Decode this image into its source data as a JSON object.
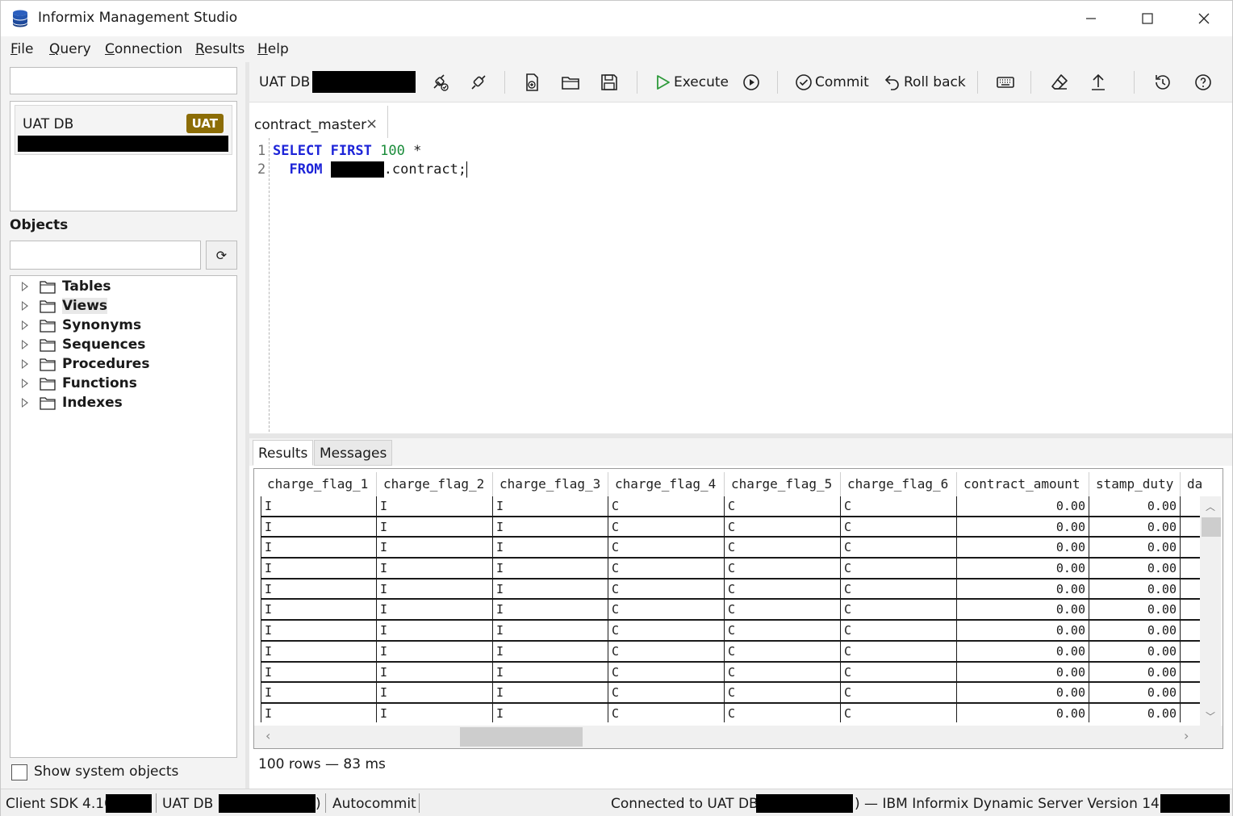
{
  "window": {
    "title": "Informix Management Studio"
  },
  "menu": [
    "File",
    "Query",
    "Connection",
    "Results",
    "Help"
  ],
  "connections": {
    "search_value": "",
    "items": [
      {
        "name": "UAT DB",
        "badge": "UAT"
      }
    ]
  },
  "objects": {
    "label": "Objects",
    "search_value": "",
    "refresh_icon": "refresh-icon",
    "tree": [
      "Tables",
      "Views",
      "Synonyms",
      "Sequences",
      "Procedures",
      "Functions",
      "Indexes"
    ],
    "show_system_label": "Show system objects"
  },
  "toolbar": {
    "connection_label": "UAT DB",
    "execute_label": "Execute",
    "commit_label": "Commit",
    "rollback_label": "Roll back"
  },
  "editor_tab": {
    "label": "contract_master",
    "close": "×"
  },
  "editor": {
    "line_numbers": [
      "1",
      "2"
    ],
    "line1_kw1": "SELECT",
    "line1_kw2": "FIRST",
    "line1_num": "100",
    "line1_rest": " *",
    "line2_kw": "FROM",
    "line2_rest": ".contract;"
  },
  "result_tabs": [
    "Results",
    "Messages"
  ],
  "grid": {
    "columns": [
      "charge_flag_1",
      "charge_flag_2",
      "charge_flag_3",
      "charge_flag_4",
      "charge_flag_5",
      "charge_flag_6",
      "contract_amount",
      "stamp_duty",
      "da"
    ],
    "rows": [
      [
        "I",
        "I",
        "I",
        "C",
        "C",
        "C",
        "0.00",
        "0.00"
      ],
      [
        "I",
        "I",
        "I",
        "C",
        "C",
        "C",
        "0.00",
        "0.00"
      ],
      [
        "I",
        "I",
        "I",
        "C",
        "C",
        "C",
        "0.00",
        "0.00"
      ],
      [
        "I",
        "I",
        "I",
        "C",
        "C",
        "C",
        "0.00",
        "0.00"
      ],
      [
        "I",
        "I",
        "I",
        "C",
        "C",
        "C",
        "0.00",
        "0.00"
      ],
      [
        "I",
        "I",
        "I",
        "C",
        "C",
        "C",
        "0.00",
        "0.00"
      ],
      [
        "I",
        "I",
        "I",
        "C",
        "C",
        "C",
        "0.00",
        "0.00"
      ],
      [
        "I",
        "I",
        "I",
        "C",
        "C",
        "C",
        "0.00",
        "0.00"
      ],
      [
        "I",
        "I",
        "I",
        "C",
        "C",
        "C",
        "0.00",
        "0.00"
      ],
      [
        "I",
        "I",
        "I",
        "C",
        "C",
        "C",
        "0.00",
        "0.00"
      ],
      [
        "I",
        "I",
        "I",
        "C",
        "C",
        "C",
        "0.00",
        "0.00"
      ]
    ],
    "row_count": "100 rows — 83 ms"
  },
  "status": {
    "sdk": "Client SDK 4.10.",
    "db_prefix": "UAT DB (",
    "db_suffix": ")",
    "autocommit": "Autocommit",
    "connected_prefix": "Connected to UAT DB (",
    "connected_suffix": ") — IBM Informix Dynamic Server Version 14.10."
  }
}
